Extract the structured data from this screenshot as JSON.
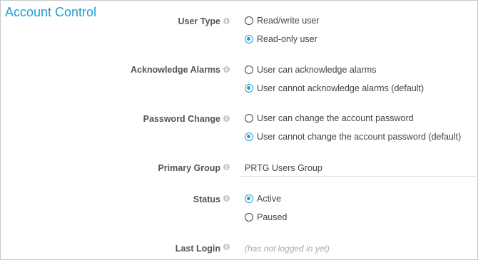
{
  "section": {
    "title": "Account Control"
  },
  "fields": {
    "user_type": {
      "label": "User Type",
      "options": [
        {
          "label": "Read/write user",
          "checked": false
        },
        {
          "label": "Read-only user",
          "checked": true
        }
      ]
    },
    "acknowledge_alarms": {
      "label": "Acknowledge Alarms",
      "options": [
        {
          "label": "User can acknowledge alarms",
          "checked": false
        },
        {
          "label": "User cannot acknowledge alarms (default)",
          "checked": true
        }
      ]
    },
    "password_change": {
      "label": "Password Change",
      "options": [
        {
          "label": "User can change the account password",
          "checked": false
        },
        {
          "label": "User cannot change the account password (default)",
          "checked": true
        }
      ]
    },
    "primary_group": {
      "label": "Primary Group",
      "value": "PRTG Users Group"
    },
    "status": {
      "label": "Status",
      "options": [
        {
          "label": "Active",
          "checked": true
        },
        {
          "label": "Paused",
          "checked": false
        }
      ]
    },
    "last_login": {
      "label": "Last Login",
      "value": "(has not logged in yet)"
    }
  },
  "icons": {
    "info": "info-icon",
    "info_glyph": "i"
  },
  "colors": {
    "accent": "#1d9dd8",
    "label": "#555555",
    "muted": "#aaaaaa"
  }
}
